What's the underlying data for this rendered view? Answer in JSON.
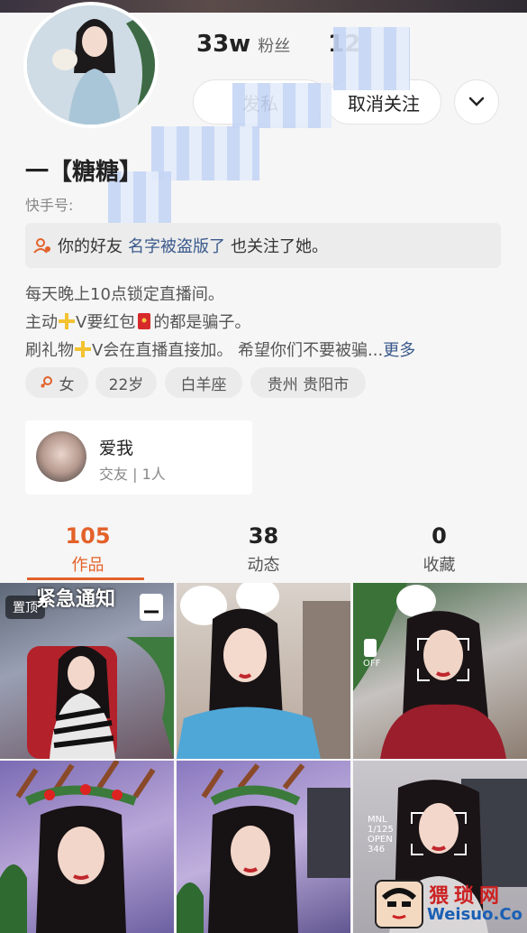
{
  "profile": {
    "followers_count": "33w",
    "followers_label": "粉丝",
    "second_stat": "12",
    "name": "一【糖糖】",
    "kuaishou_label": "快手号:",
    "follow_button": "发私",
    "unfollow_button": "取消关注"
  },
  "friend": {
    "prefix": "你的好友",
    "name": "名字被盗版了",
    "suffix": "也关注了她。"
  },
  "bio": {
    "line1": "每天晚上10点锁定直播间。",
    "line2a": "主动",
    "line2b": "V要红包",
    "line2c": "的都是骗子。",
    "line3a": "刷礼物",
    "line3b": "V会在直播直接加。 希望你们不要被骗...",
    "more": "更多"
  },
  "tags": [
    "女",
    "22岁",
    "白羊座",
    "贵州 贵阳市"
  ],
  "group": {
    "title": "爱我",
    "subtitle": "交友 | 1人"
  },
  "tabs": [
    {
      "count": "105",
      "label": "作品"
    },
    {
      "count": "38",
      "label": "动态"
    },
    {
      "count": "0",
      "label": "收藏"
    }
  ],
  "grid": {
    "pinned_label": "置顶",
    "notice_text": "紧急通知",
    "camera_off_label": "OFF",
    "camera_info": [
      "MNL",
      "1/125",
      "OPEN",
      "346"
    ]
  },
  "watermark": {
    "chinese": "猥琐网",
    "english": "Weisuo.Co"
  },
  "colors": {
    "accent": "#e3612a",
    "link": "#3a5a8c",
    "background": "#f6f6f6"
  },
  "icons": [
    "chevron-down-icon",
    "friends-icon",
    "female-icon",
    "plus-icon",
    "red-envelope-icon",
    "camera-icon"
  ]
}
